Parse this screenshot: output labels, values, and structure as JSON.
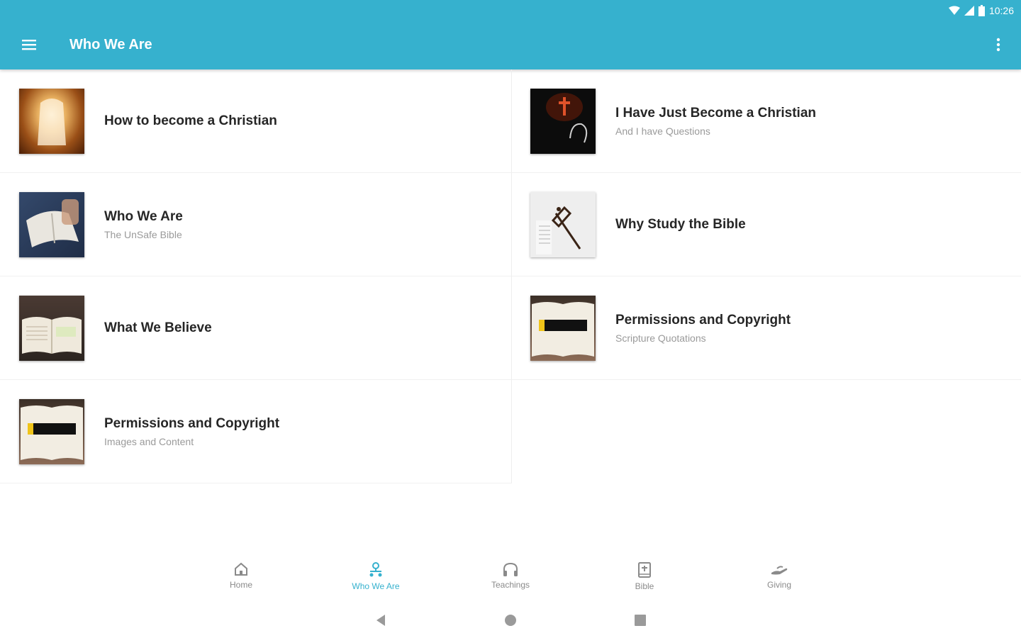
{
  "status_bar": {
    "time": "10:26"
  },
  "app_bar": {
    "title": "Who We Are"
  },
  "cards": [
    {
      "title": "How to become a Christian",
      "subtitle": ""
    },
    {
      "title": "I Have Just Become a Christian",
      "subtitle": "And I have Questions"
    },
    {
      "title": "Who We Are",
      "subtitle": "The UnSafe Bible"
    },
    {
      "title": "Why Study the Bible",
      "subtitle": ""
    },
    {
      "title": "What We Believe",
      "subtitle": ""
    },
    {
      "title": "Permissions and Copyright",
      "subtitle": "Scripture Quotations"
    },
    {
      "title": "Permissions and Copyright",
      "subtitle": "Images and Content"
    }
  ],
  "bottom_nav": {
    "items": [
      {
        "label": "Home",
        "icon": "home-icon"
      },
      {
        "label": "Who We Are",
        "icon": "people-icon",
        "active": true
      },
      {
        "label": "Teachings",
        "icon": "headphones-icon"
      },
      {
        "label": "Bible",
        "icon": "bible-icon"
      },
      {
        "label": "Giving",
        "icon": "giving-icon"
      }
    ]
  },
  "colors": {
    "accent": "#36b1ce",
    "title_text": "#262626",
    "subtitle_text": "#9a9a9a"
  }
}
